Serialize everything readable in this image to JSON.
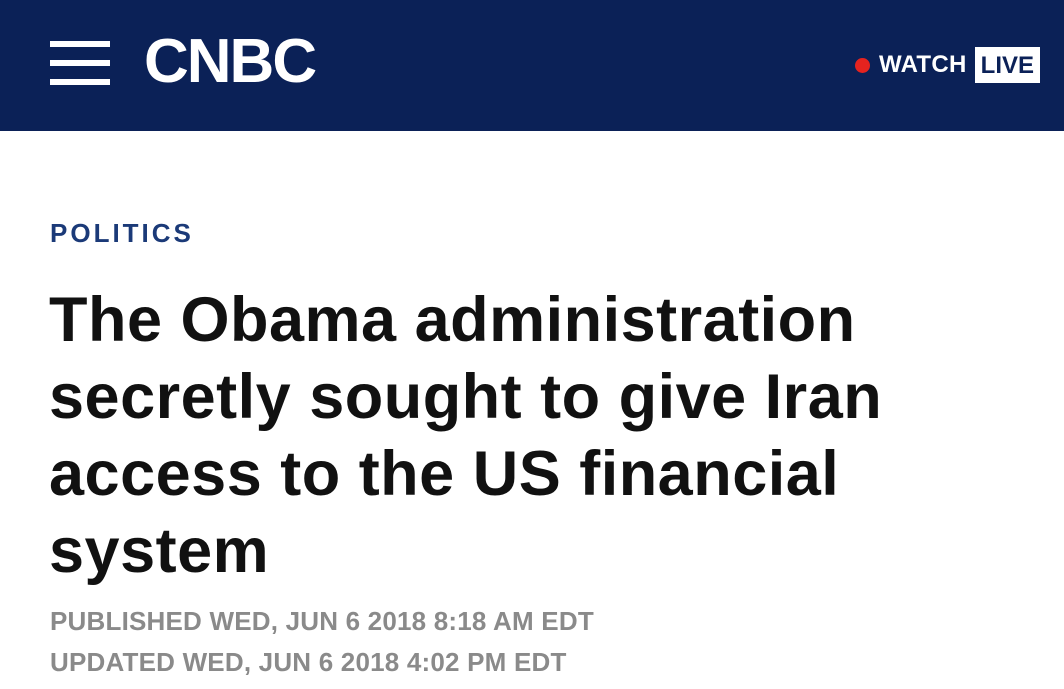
{
  "header": {
    "logo_text": "CNBC",
    "menu_icon": "hamburger-menu-icon",
    "watch_label": "WATCH",
    "live_label": "LIVE",
    "live_dot_color": "#e5231f",
    "background_color": "#0b2157"
  },
  "article": {
    "category": "POLITICS",
    "headline": "The Obama administration secretly sought to give Iran access to the US financial system",
    "published": "PUBLISHED WED, JUN 6 2018 8:18 AM EDT",
    "updated": "UPDATED WED, JUN 6 2018 4:02 PM EDT"
  }
}
